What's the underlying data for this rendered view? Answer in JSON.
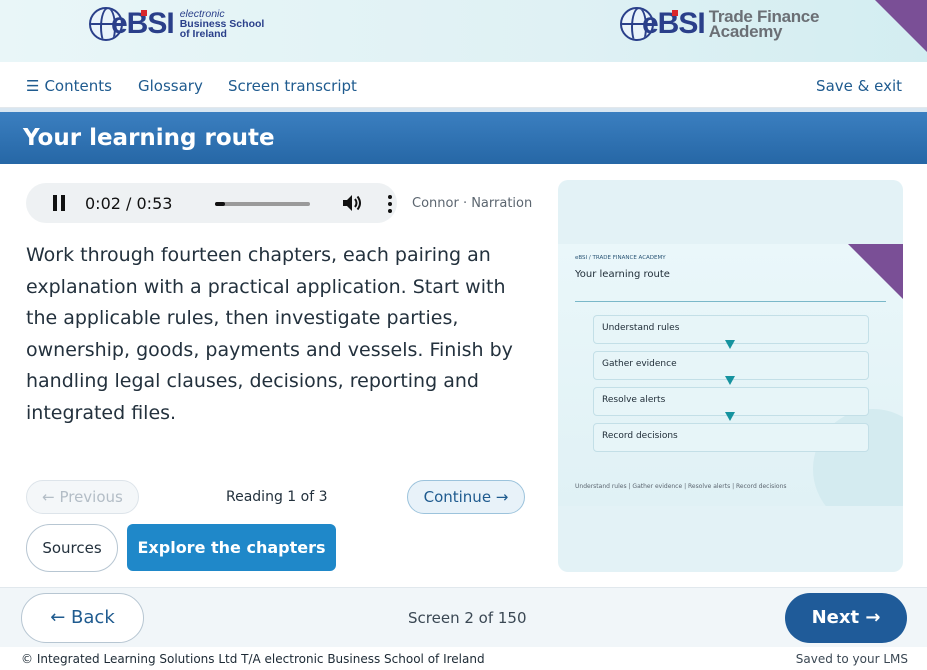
{
  "brand": {
    "left_mark": "eBSI",
    "left_sub_line1": "electronic",
    "left_sub_line2": "Business School",
    "left_sub_line3": "of Ireland",
    "right_mark": "eBSI",
    "right_sub_line1": "Trade Finance",
    "right_sub_line2": "Academy",
    "accent_purple": "#7a4f96",
    "brand_blue": "#2a3f8a"
  },
  "nav": {
    "contents_label": "Contents",
    "glossary_label": "Glossary",
    "transcript_label": "Screen transcript",
    "save_label": "Save & exit",
    "contents_icon": "hamburger-icon"
  },
  "page": {
    "title": "Your learning route"
  },
  "audio": {
    "time": "0:02 / 0:53",
    "progress": 0.04,
    "narrator": "Connor · Narration",
    "icons": [
      "pause-icon",
      "volume-icon",
      "more-options-icon"
    ]
  },
  "body": {
    "text": "Work through fourteen chapters, each pairing an explanation with a practical application. Start with the applicable rules, then investigate parties, ownership, goods, payments and vessels. Finish by handling legal clauses, decisions, reporting and integrated files."
  },
  "pager": {
    "previous_label": "← Previous",
    "reading_label": "Reading 1 of 3",
    "continue_label": "Continue →"
  },
  "actions": {
    "sources_label": "Sources",
    "explore_label": "Explore the chapters"
  },
  "preview": {
    "kicker": "eBSI / TRADE FINANCE ACADEMY",
    "title": "Your learning route",
    "steps": [
      "Understand rules",
      "Gather evidence",
      "Resolve alerts",
      "Record decisions"
    ],
    "footer": "Understand rules | Gather evidence | Resolve alerts | Record decisions"
  },
  "bottom": {
    "back_label": "← Back",
    "screen_label": "Screen 2 of 150",
    "next_label": "Next →"
  },
  "footer": {
    "copyright": "© Integrated Learning Solutions Ltd T/A electronic Business School of Ireland",
    "saved": "Saved to your LMS"
  }
}
